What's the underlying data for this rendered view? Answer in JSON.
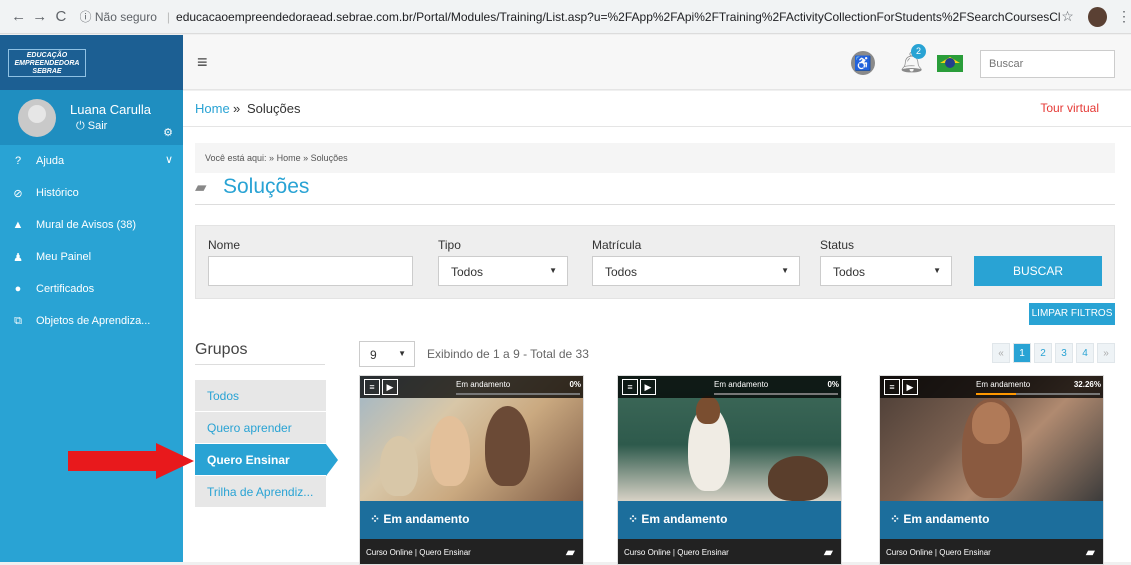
{
  "browser": {
    "back": "←",
    "forward": "→",
    "reload": "C",
    "security": "ⓘ Não seguro",
    "url": "educacaoempreendedoraead.sebrae.com.br/Portal/Modules/Training/List.asp?u=%2FApp%2FApi%2FTraining%2FActivityCollectionForStudents%2FSearchCoursesCl..."
  },
  "logo": {
    "line1": "EDUCAÇÃO",
    "line2": "EMPREENDEDORA",
    "line3": "SEBRAE"
  },
  "user": {
    "name": "Luana Carulla",
    "logout": "Sair"
  },
  "sidebar": {
    "items": [
      {
        "label": "Ajuda",
        "icon": "?"
      },
      {
        "label": "Histórico",
        "icon": "⊘"
      },
      {
        "label": "Mural de Avisos (38)",
        "icon": "▲"
      },
      {
        "label": "Meu Painel",
        "icon": "♟"
      },
      {
        "label": "Certificados",
        "icon": "●"
      },
      {
        "label": "Objetos de Aprendiza...",
        "icon": "⧉"
      }
    ]
  },
  "topbar": {
    "notifications_count": "2",
    "search_placeholder": "Buscar"
  },
  "breadcrumb": {
    "home": "Home",
    "sep": "»",
    "current": "Soluções",
    "tour": "Tour virtual"
  },
  "main": {
    "you_are_here": "Você está aqui: »",
    "you_home": "Home",
    "you_sep": "»",
    "you_current": "Soluções",
    "title": "Soluções"
  },
  "filters": {
    "name_label": "Nome",
    "type_label": "Tipo",
    "type_value": "Todos",
    "enroll_label": "Matrícula",
    "enroll_value": "Todos",
    "status_label": "Status",
    "status_value": "Todos",
    "search_button": "BUSCAR",
    "clear_button": "LIMPAR FILTROS"
  },
  "groups": {
    "title": "Grupos",
    "items": [
      {
        "label": "Todos"
      },
      {
        "label": "Quero aprender"
      },
      {
        "label": "Quero Ensinar"
      },
      {
        "label": "Trilha de Aprendiz..."
      }
    ]
  },
  "listing": {
    "per_page": "9",
    "showing": "Exibindo de 1 a 9 - Total de 33",
    "pager": [
      "«",
      "1",
      "2",
      "3",
      "4",
      "»"
    ]
  },
  "cards": [
    {
      "status_top": "Em andamento",
      "percent": "0%",
      "progress": 0,
      "status": "Em andamento",
      "type": "Curso Online",
      "group": "Quero Ensinar"
    },
    {
      "status_top": "Em andamento",
      "percent": "0%",
      "progress": 0,
      "status": "Em andamento",
      "type": "Curso Online",
      "group": "Quero Ensinar"
    },
    {
      "status_top": "Em andamento",
      "percent": "32.26%",
      "progress": 0.3226,
      "status": "Em andamento",
      "type": "Curso Online",
      "group": "Quero Ensinar"
    }
  ],
  "colors": {
    "accent": "#29a3d4",
    "sidebar_dark": "#1c5f93",
    "tour": "#e53935",
    "arrow": "#e8191c"
  }
}
